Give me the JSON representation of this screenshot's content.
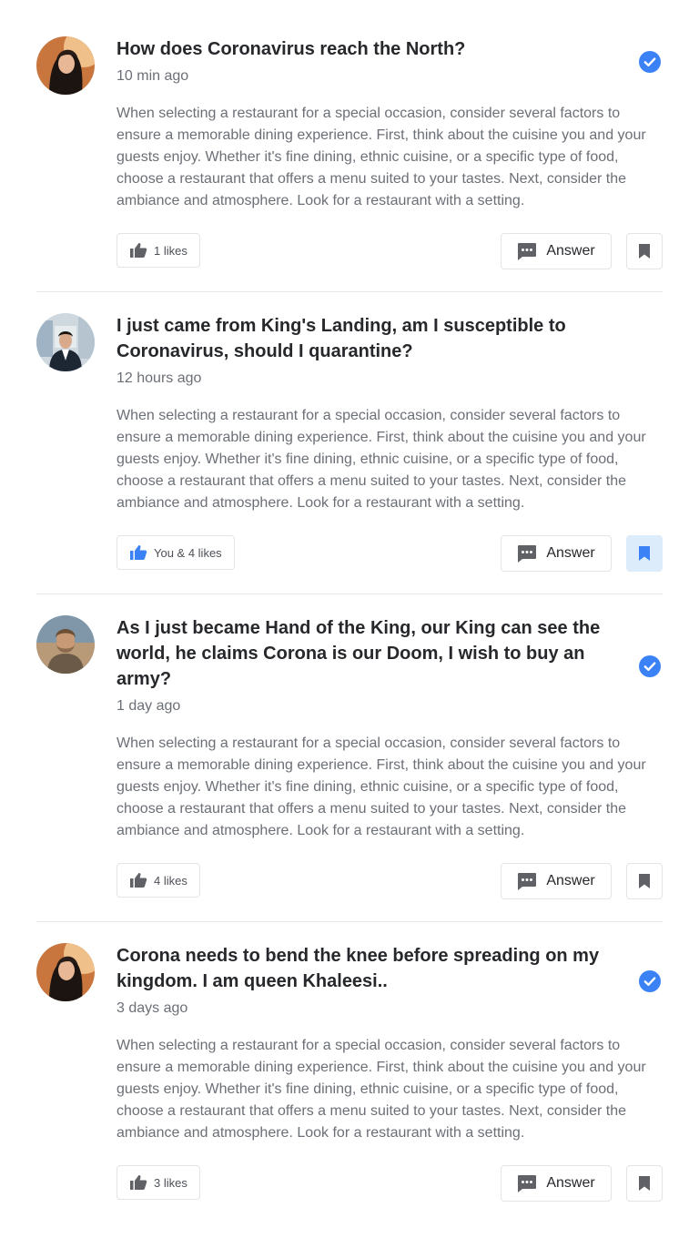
{
  "colors": {
    "accent": "#3b82f6",
    "icon_gray": "#5f6166",
    "bookmark_active_bg": "#dcecfb"
  },
  "posts": [
    {
      "title": "How does Coronavirus reach the North?",
      "time": "10 min ago",
      "body": "When selecting a restaurant for a special occasion, consider several factors to ensure a memorable dining experience. First, think about the cuisine you and your guests enjoy. Whether it's fine dining, ethnic cuisine, or a specific type of food, choose a restaurant that offers a menu suited to your tastes. Next, consider the ambiance and atmosphere. Look for a restaurant with a setting.",
      "likes": "1 likes",
      "liked": false,
      "answer_label": "Answer",
      "bookmarked": false,
      "verified": true,
      "avatar_icon": "avatar-woman-icon"
    },
    {
      "title": "I just came from King's Landing, am I susceptible to Coronavirus, should I quarantine?",
      "time": "12 hours ago",
      "body": "When selecting a restaurant for a special occasion, consider several factors to ensure a memorable dining experience. First, think about the cuisine you and your guests enjoy. Whether it's fine dining, ethnic cuisine, or a specific type of food, choose a restaurant that offers a menu suited to your tastes. Next, consider the ambiance and atmosphere. Look for a restaurant with a setting.",
      "likes": "You & 4 likes",
      "liked": true,
      "answer_label": "Answer",
      "bookmarked": true,
      "verified": false,
      "avatar_icon": "avatar-man-suit-icon"
    },
    {
      "title": "As I just became Hand of the King, our King can see the world, he claims Corona is our Doom, I wish to buy an army?",
      "time": "1 day ago",
      "body": "When selecting a restaurant for a special occasion, consider several factors to ensure a memorable dining experience. First, think about the cuisine you and your guests enjoy. Whether it's fine dining, ethnic cuisine, or a specific type of food, choose a restaurant that offers a menu suited to your tastes. Next, consider the ambiance and atmosphere. Look for a restaurant with a setting.",
      "likes": "4 likes",
      "liked": false,
      "answer_label": "Answer",
      "bookmarked": false,
      "verified": true,
      "avatar_icon": "avatar-man-beard-icon"
    },
    {
      "title": "Corona needs to bend the knee before spreading on my kingdom. I am queen Khaleesi..",
      "time": "3 days ago",
      "body": "When selecting a restaurant for a special occasion, consider several factors to ensure a memorable dining experience. First, think about the cuisine you and your guests enjoy. Whether it's fine dining, ethnic cuisine, or a specific type of food, choose a restaurant that offers a menu suited to your tastes. Next, consider the ambiance and atmosphere. Look for a restaurant with a setting.",
      "likes": "3 likes",
      "liked": false,
      "answer_label": "Answer",
      "bookmarked": false,
      "verified": true,
      "avatar_icon": "avatar-woman-icon"
    }
  ]
}
